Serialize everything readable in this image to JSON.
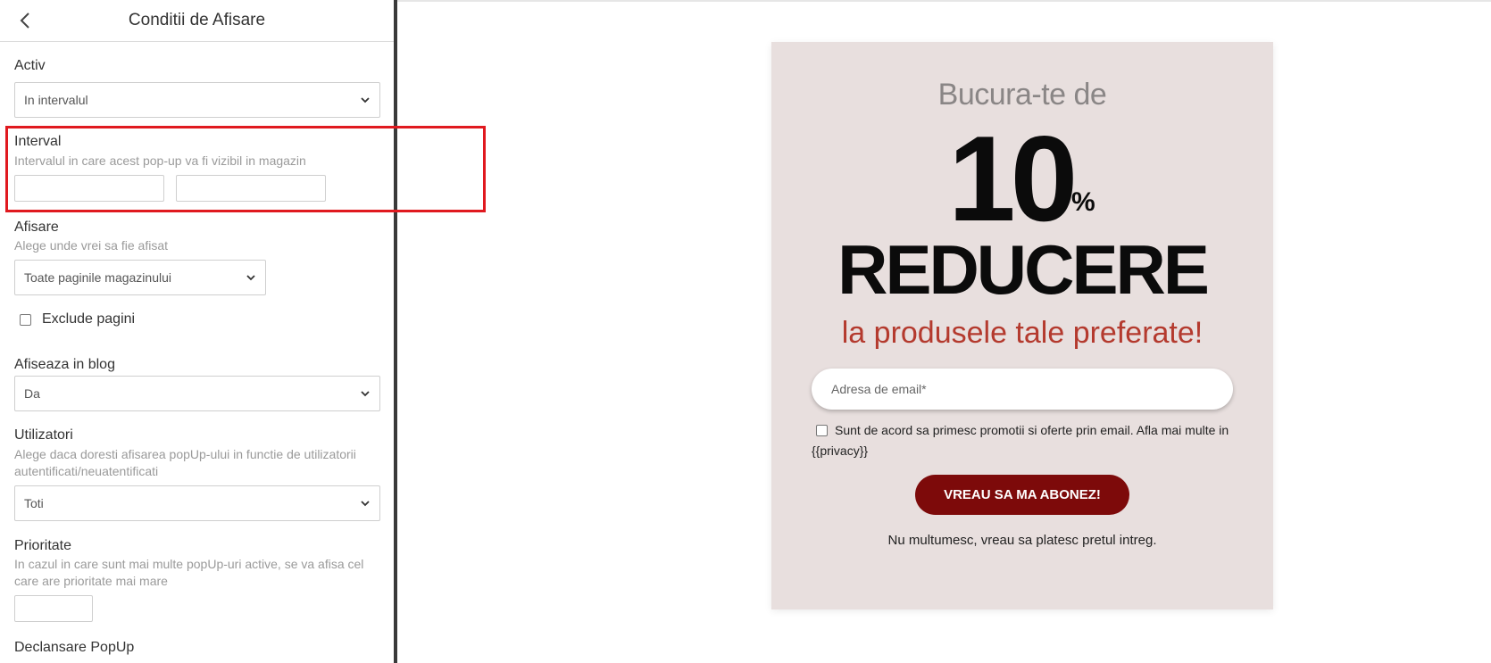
{
  "sidebar": {
    "title": "Conditii de Afisare",
    "back_icon": "chevron-left-icon",
    "activ": {
      "label": "Activ",
      "value": "In intervalul"
    },
    "interval": {
      "label": "Interval",
      "help": "Intervalul in care acest pop-up va fi vizibil in magazin",
      "start": "",
      "end": ""
    },
    "afisare": {
      "label": "Afisare",
      "help": "Alege unde vrei sa fie afisat",
      "value": "Toate paginile magazinului"
    },
    "exclude": {
      "label": "Exclude pagini",
      "checked": false
    },
    "blog": {
      "label": "Afiseaza in blog",
      "value": "Da"
    },
    "utilizatori": {
      "label": "Utilizatori",
      "help": "Alege daca doresti afisarea popUp-ului in functie de utilizatorii autentificati/neuatentificati",
      "value": "Toti"
    },
    "prioritate": {
      "label": "Prioritate",
      "help": "In cazul in care sunt mai multe popUp-uri active, se va afisa cel care are prioritate mai mare",
      "value": ""
    },
    "declansare": {
      "label": "Declansare PopUp"
    }
  },
  "popup": {
    "headline": "Bucura-te de",
    "number": "10",
    "percent": "%",
    "reducere": "REDUCERE",
    "subline": "la produsele tale preferate!",
    "email_placeholder": "Adresa de email*",
    "consent": "Sunt de acord sa primesc promotii si oferte prin email. Afla mai multe in {{privacy}}",
    "cta": "VREAU SA MA ABONEZ!",
    "decline": "Nu multumesc, vreau sa platesc pretul intreg."
  },
  "colors": {
    "highlight": "#e0191f",
    "popup_bg": "#e8dfde",
    "accent_red": "#b43a2e",
    "button": "#7d0a0a"
  }
}
